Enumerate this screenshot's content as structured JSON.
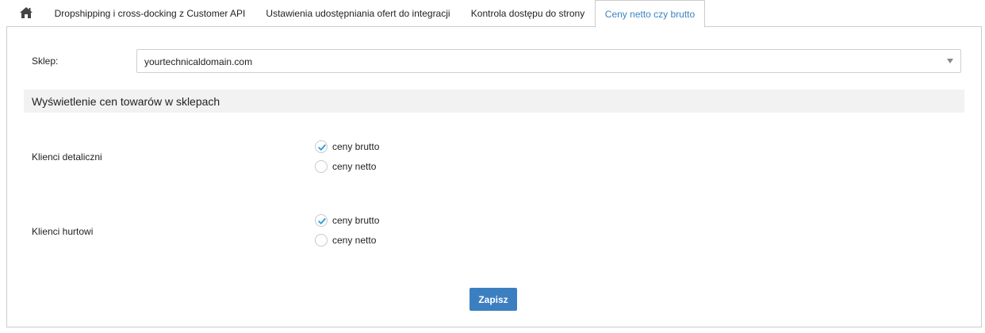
{
  "tabs": {
    "home_icon": "home-icon",
    "items": [
      {
        "label": "Dropshipping i cross-docking z Customer API"
      },
      {
        "label": "Ustawienia udostępniania ofert do integracji"
      },
      {
        "label": "Kontrola dostępu do strony"
      },
      {
        "label": "Ceny netto czy brutto",
        "active": true
      }
    ]
  },
  "shop": {
    "label": "Sklep:",
    "selected": "yourtechnicaldomain.com"
  },
  "section": {
    "title": "Wyświetlenie cen towarów w sklepach"
  },
  "groups": [
    {
      "label": "Klienci detaliczni",
      "options": [
        {
          "label": "ceny brutto",
          "checked": true
        },
        {
          "label": "ceny netto",
          "checked": false
        }
      ]
    },
    {
      "label": "Klienci hurtowi",
      "options": [
        {
          "label": "ceny brutto",
          "checked": true
        },
        {
          "label": "ceny netto",
          "checked": false
        }
      ]
    }
  ],
  "actions": {
    "save_label": "Zapisz"
  },
  "colors": {
    "accent": "#3c83c2",
    "button": "#3c7fc1",
    "check": "#3c9fd8",
    "section_bg": "#f2f2f2",
    "border": "#cccccc"
  }
}
